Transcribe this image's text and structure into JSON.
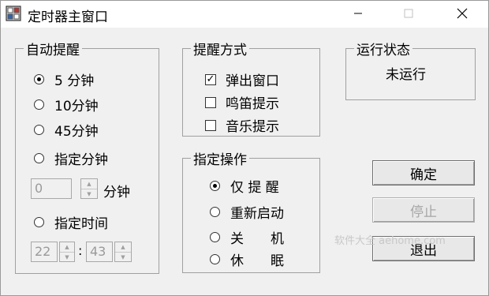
{
  "window": {
    "title": "定时器主窗口"
  },
  "reminder_group": {
    "title": "自动提醒",
    "options": [
      "5 分钟",
      "10分钟",
      "45分钟",
      "指定分钟",
      "指定时间"
    ],
    "minutes_value": "0",
    "minutes_unit": "分钟",
    "hour_value": "22",
    "time_separator": ":",
    "minute_value": "43"
  },
  "method_group": {
    "title": "提醒方式",
    "options": [
      {
        "label": "弹出窗口",
        "checked": true
      },
      {
        "label": "鸣笛提示",
        "checked": false
      },
      {
        "label": "音乐提示",
        "checked": false
      }
    ]
  },
  "status_group": {
    "title": "运行状态",
    "value": "未运行"
  },
  "action_group": {
    "title": "指定操作",
    "options": [
      "仅 提 醒",
      "重新启动",
      "关　　机",
      "休　　眠"
    ]
  },
  "buttons": {
    "ok": "确定",
    "stop": "停止",
    "exit": "退出"
  },
  "watermark": "软件大全 aehome.com"
}
